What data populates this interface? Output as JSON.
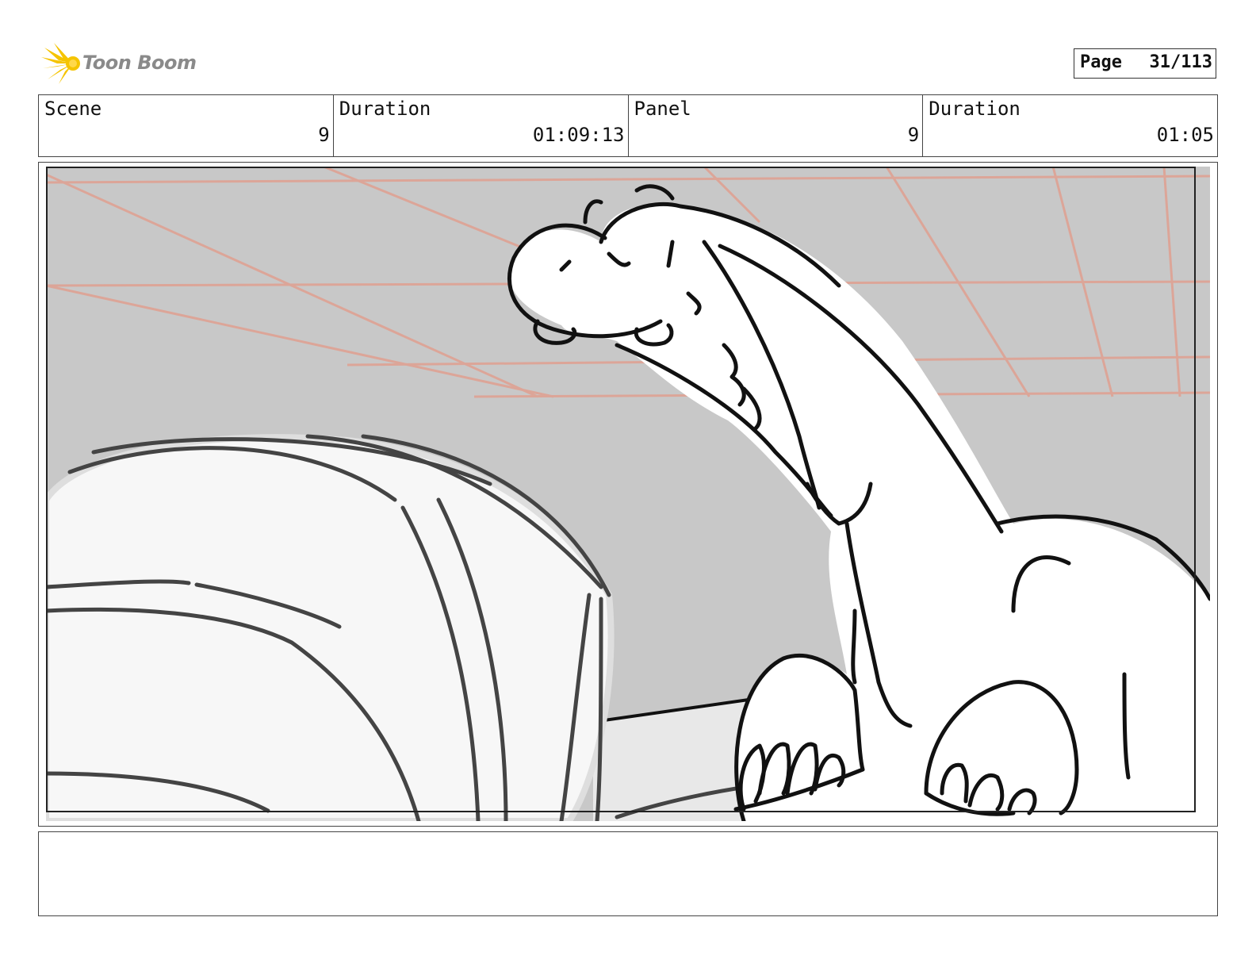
{
  "brand": {
    "name": "Toon Boom",
    "logo_icon": "starburst-logo-icon",
    "accent": "#f5c400"
  },
  "page": {
    "label": "Page",
    "number": "31/113"
  },
  "header": {
    "cells": [
      {
        "label": "Scene",
        "value": "9"
      },
      {
        "label": "Duration",
        "value": "01:09:13"
      },
      {
        "label": "Panel",
        "value": "9"
      },
      {
        "label": "Duration",
        "value": "01:05"
      }
    ]
  },
  "panel": {
    "image": "storyboard-sketch",
    "subject": "cartoon dinosaur laughing at low-angle view with cushion in foreground",
    "background_color": "#c8c8c8",
    "guide_line_color": "#e0a090"
  },
  "notes": {
    "text": ""
  }
}
